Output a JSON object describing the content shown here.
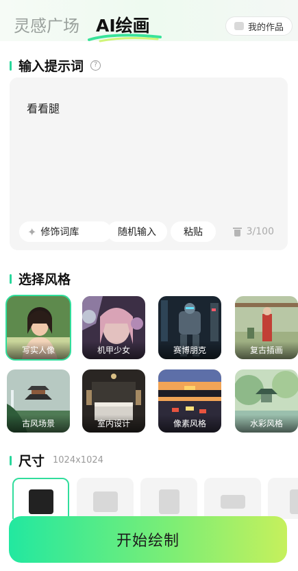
{
  "header": {
    "tabs": [
      {
        "label": "灵感广场",
        "active": false
      },
      {
        "label": "AI绘画",
        "active": true
      }
    ],
    "my_works_label": "我的作品"
  },
  "prompt": {
    "title": "输入提示词",
    "help_icon": "?",
    "value": "看看腿",
    "chips": [
      "修饰词库",
      "随机输入",
      "粘贴"
    ],
    "counter": "3/100"
  },
  "style_section": {
    "title": "选择风格",
    "items": [
      {
        "label": "写实人像",
        "selected": true
      },
      {
        "label": "机甲少女",
        "selected": false
      },
      {
        "label": "赛博朋克",
        "selected": false
      },
      {
        "label": "复古插画",
        "selected": false
      },
      {
        "label": "古风场景",
        "selected": false
      },
      {
        "label": "室内设计",
        "selected": false
      },
      {
        "label": "像素风格",
        "selected": false
      },
      {
        "label": "水彩风格",
        "selected": false
      }
    ]
  },
  "size_section": {
    "title": "尺寸",
    "current": "1024x1024"
  },
  "start_button": "开始绘制",
  "colors": {
    "accent": "#30dd9c",
    "button_gradient_start": "#22e8a0",
    "button_gradient_end": "#c6f05c"
  }
}
